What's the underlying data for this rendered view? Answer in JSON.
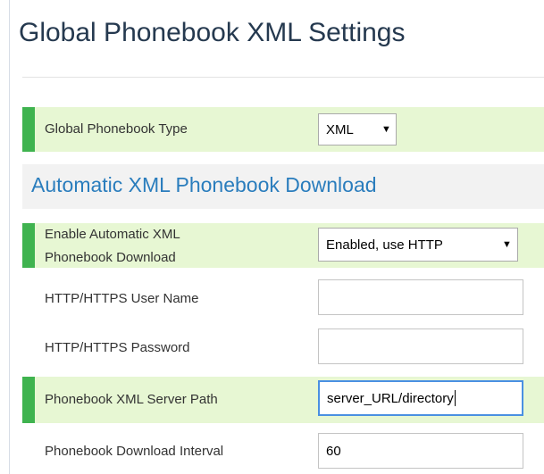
{
  "page": {
    "title": "Global Phonebook XML Settings"
  },
  "phonebook_type": {
    "label": "Global Phonebook Type",
    "value": "XML"
  },
  "section": {
    "title": "Automatic XML Phonebook Download"
  },
  "enable_download": {
    "label_line1": "Enable Automatic XML",
    "label_line2": "Phonebook Download",
    "value": "Enabled, use HTTP"
  },
  "username": {
    "label": "HTTP/HTTPS User Name",
    "value": ""
  },
  "password": {
    "label": "HTTP/HTTPS Password",
    "value": ""
  },
  "server_path": {
    "label": "Phonebook XML Server Path",
    "value": "server_URL/directory"
  },
  "download_interval": {
    "label": "Phonebook Download Interval",
    "value": "60"
  },
  "colors": {
    "highlight_row": "#e7f7d3",
    "marker": "#3fb34f",
    "section_title": "#2a7dbd",
    "page_title": "#25394f"
  }
}
